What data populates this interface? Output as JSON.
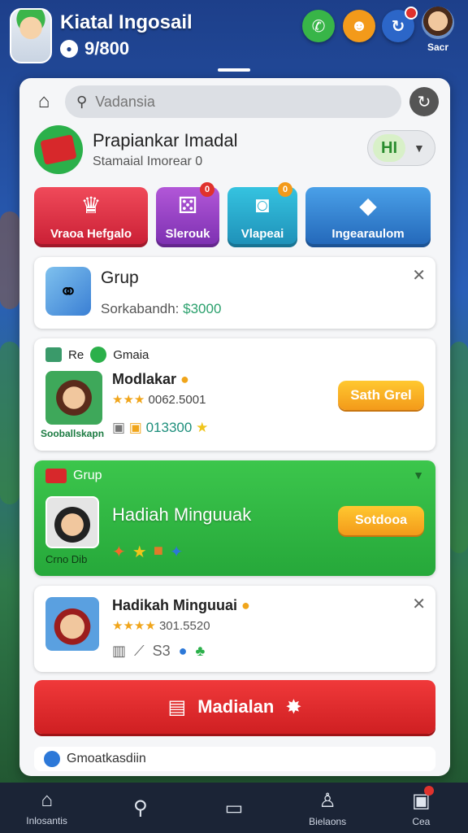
{
  "header": {
    "title": "Kiatal Ingosail",
    "coins": "9/800",
    "profile_label": "Sacr"
  },
  "search": {
    "placeholder": "Vadansia"
  },
  "profile": {
    "name": "Prapiankar Imadal",
    "subtitle": "Stamaial Imorear 0",
    "toggle_value": "HI"
  },
  "tiles": [
    {
      "label": "Vraoa Hefgalo",
      "icon": "crown-icon",
      "badge": ""
    },
    {
      "label": "Slerouk",
      "icon": "dice-icon",
      "badge": "0"
    },
    {
      "label": "Vlapeai",
      "icon": "camera-icon",
      "badge": "0"
    },
    {
      "label": "Ingearaulom",
      "icon": "gold-icon",
      "badge": ""
    }
  ],
  "cards": {
    "grup": {
      "title": "Grup",
      "sub_label": "Sorkabandh:",
      "sub_value": "$3000"
    },
    "player": {
      "header_a": "Re",
      "header_b": "Gmaia",
      "name": "Modlakar",
      "rating": "0062.5001",
      "pic_label": "Sooballskapn",
      "meta": "013300",
      "button": "Sath Grel"
    },
    "weekly_green": {
      "header": "Grup",
      "title": "Hadiah Minguuak",
      "pic_label": "Crno Dib",
      "button": "Sotdooa"
    },
    "weekly": {
      "title": "Hadikah Minguuai",
      "rating": "301.5520",
      "meta": "S3"
    }
  },
  "main_button": {
    "label": "Madialan"
  },
  "footer_row": {
    "label": "Gmoatkasdiin"
  },
  "nav": [
    {
      "label": "Inlosantis",
      "icon": "home-icon"
    },
    {
      "label": "",
      "icon": "search-icon"
    },
    {
      "label": "",
      "icon": "cards-icon"
    },
    {
      "label": "Bielaons",
      "icon": "trophy-icon"
    },
    {
      "label": "Cea",
      "icon": "chat-icon"
    }
  ],
  "colors": {
    "accent_green": "#2bb04a",
    "accent_red": "#d7282b",
    "accent_orange": "#f39a1a"
  }
}
